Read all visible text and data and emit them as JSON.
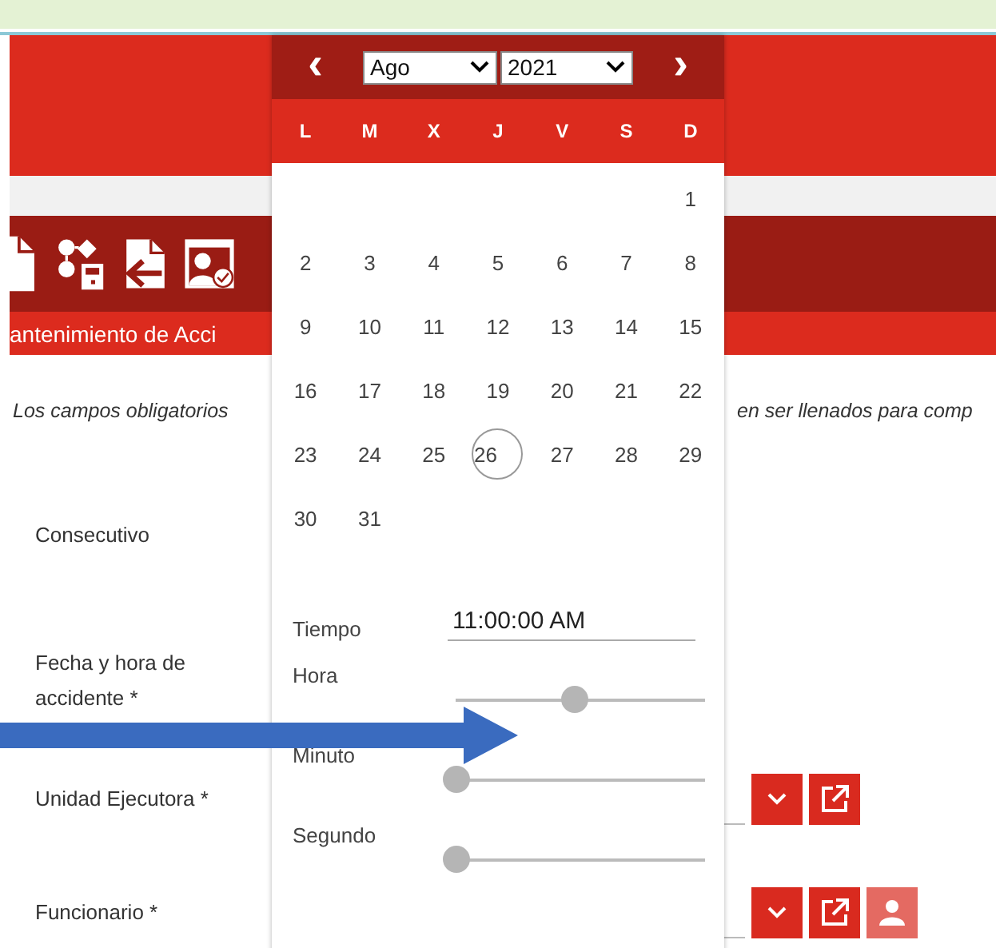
{
  "page_title": "antenimiento de Acci",
  "notice": [
    "Los campos obligatorios",
    "en ser llenados para comp"
  ],
  "form": {
    "fields": [
      {
        "label": "Consecutivo"
      },
      {
        "label": "Fecha y hora de accidente *"
      },
      {
        "label": "Unidad Ejecutora *",
        "actions": [
          {
            "kind": "dropdown",
            "disabled": false
          },
          {
            "kind": "open",
            "disabled": false
          }
        ]
      },
      {
        "label": "Funcionario *",
        "actions": [
          {
            "kind": "dropdown",
            "disabled": false
          },
          {
            "kind": "open",
            "disabled": false
          },
          {
            "kind": "person",
            "disabled": true
          }
        ]
      }
    ]
  },
  "datepicker": {
    "prev": "‹",
    "next": "›",
    "month": "Ago",
    "year": "2021",
    "weekdays": [
      "L",
      "M",
      "X",
      "J",
      "V",
      "S",
      "D"
    ],
    "weeks": [
      [
        {
          "kind": "blank"
        },
        {
          "kind": "blank"
        },
        {
          "kind": "blank"
        },
        {
          "kind": "blank"
        },
        {
          "kind": "blank"
        },
        {
          "kind": "blank"
        },
        {
          "kind": "day",
          "day": "1",
          "selected": false
        }
      ],
      [
        {
          "kind": "day",
          "day": "2",
          "selected": false
        },
        {
          "kind": "day",
          "day": "3",
          "selected": false
        },
        {
          "kind": "day",
          "day": "4",
          "selected": false
        },
        {
          "kind": "day",
          "day": "5",
          "selected": false
        },
        {
          "kind": "day",
          "day": "6",
          "selected": false
        },
        {
          "kind": "day",
          "day": "7",
          "selected": false
        },
        {
          "kind": "day",
          "day": "8",
          "selected": false
        }
      ],
      [
        {
          "kind": "day",
          "day": "9",
          "selected": false
        },
        {
          "kind": "day",
          "day": "10",
          "selected": false
        },
        {
          "kind": "day",
          "day": "11",
          "selected": false
        },
        {
          "kind": "day",
          "day": "12",
          "selected": false
        },
        {
          "kind": "day",
          "day": "13",
          "selected": false
        },
        {
          "kind": "day",
          "day": "14",
          "selected": false
        },
        {
          "kind": "day",
          "day": "15",
          "selected": false
        }
      ],
      [
        {
          "kind": "day",
          "day": "16",
          "selected": false
        },
        {
          "kind": "day",
          "day": "17",
          "selected": false
        },
        {
          "kind": "day",
          "day": "18",
          "selected": false
        },
        {
          "kind": "day",
          "day": "19",
          "selected": false
        },
        {
          "kind": "day",
          "day": "20",
          "selected": false
        },
        {
          "kind": "day",
          "day": "21",
          "selected": false
        },
        {
          "kind": "day",
          "day": "22",
          "selected": false
        }
      ],
      [
        {
          "kind": "day",
          "day": "23",
          "selected": false
        },
        {
          "kind": "day",
          "day": "24",
          "selected": false
        },
        {
          "kind": "day",
          "day": "25",
          "selected": false
        },
        {
          "kind": "day",
          "day": "26",
          "selected": true
        },
        {
          "kind": "day",
          "day": "27",
          "selected": false
        },
        {
          "kind": "day",
          "day": "28",
          "selected": false
        },
        {
          "kind": "day",
          "day": "29",
          "selected": false
        }
      ],
      [
        {
          "kind": "day",
          "day": "30",
          "selected": false
        },
        {
          "kind": "day",
          "day": "31",
          "selected": false
        }
      ]
    ],
    "time": {
      "label": "Tiempo",
      "value": "11:00:00 AM"
    },
    "sliders": [
      {
        "label": "Hora",
        "level": 0.5
      },
      {
        "label": "Minuto",
        "level": 0
      },
      {
        "label": "Segundo",
        "level": 0
      }
    ]
  }
}
